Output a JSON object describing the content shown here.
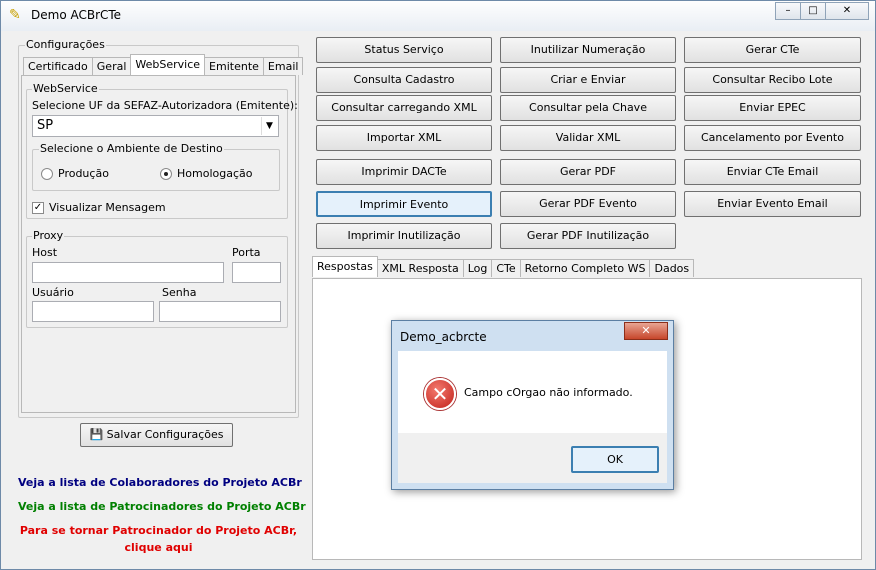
{
  "window": {
    "title": "Demo ACBrCTe",
    "minimize": "–",
    "maximize": "□",
    "close": "✕"
  },
  "config": {
    "title": "Configurações",
    "tabs": [
      "Certificado",
      "Geral",
      "WebService",
      "Emitente",
      "Email"
    ],
    "webservice": {
      "title": "WebService",
      "uf_label": "Selecione UF da SEFAZ-Autorizadora (Emitente):",
      "uf_value": "SP",
      "ambiente_title": "Selecione o Ambiente de Destino",
      "producao": "Produção",
      "homologacao": "Homologação",
      "visualizar": "Visualizar Mensagem"
    },
    "proxy": {
      "title": "Proxy",
      "host": "Host",
      "porta": "Porta",
      "usuario": "Usuário",
      "senha": "Senha"
    },
    "save_button": "Salvar Configurações"
  },
  "links": {
    "colaboradores": "Veja a lista de Colaboradores do Projeto ACBr",
    "patrocinadores": "Veja a lista de Patrocinadores do Projeto ACBr",
    "tornar_1": "Para se tornar Patrocinador do Projeto ACBr,",
    "tornar_2": "clique aqui",
    "colors": {
      "blue": "#000080",
      "green": "#008000",
      "red": "#e00000"
    }
  },
  "actions": {
    "col1": [
      "Status Serviço",
      "Consulta Cadastro",
      "Consultar carregando XML",
      "Importar XML",
      "Imprimir DACTe",
      "Imprimir Evento",
      "Imprimir Inutilização"
    ],
    "col2": [
      "Inutilizar Numeração",
      "Criar e Enviar",
      "Consultar pela Chave",
      "Validar XML",
      "Gerar PDF",
      "Gerar PDF Evento",
      "Gerar PDF Inutilização"
    ],
    "col3": [
      "Gerar CTe",
      "Consultar Recibo Lote",
      "Enviar EPEC",
      "Cancelamento por Evento",
      "Enviar CTe Email",
      "Enviar Evento Email"
    ]
  },
  "result_tabs": [
    "Respostas",
    "XML Resposta",
    "Log",
    "CTe",
    "Retorno Completo WS",
    "Dados"
  ],
  "dialog": {
    "title": "Demo_acbrcte",
    "close": "✕",
    "message": "Campo cOrgao não informado.",
    "ok": "OK",
    "icon": "error-icon"
  }
}
